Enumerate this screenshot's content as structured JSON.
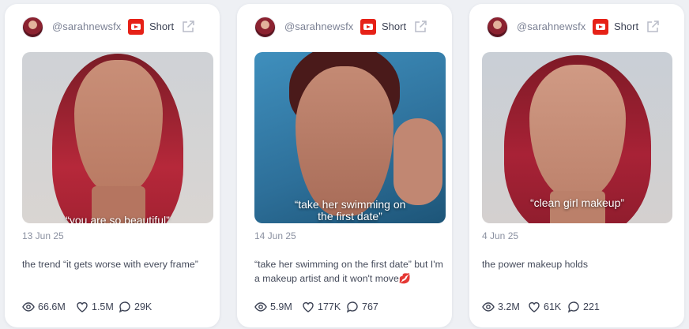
{
  "posts": [
    {
      "author": "@sarahnewsfx",
      "platform": "youtube",
      "type_label": "Short",
      "thumbnail_caption": "“you are so beautiful”",
      "date": "13 Jun 25",
      "description": "the trend “it gets worse with every frame”",
      "views": "66.6M",
      "likes": "1.5M",
      "comments": "29K"
    },
    {
      "author": "@sarahnewsfx",
      "platform": "youtube",
      "type_label": "Short",
      "thumbnail_caption": "“take her swimming on the first date”",
      "date": "14 Jun 25",
      "description": "“take her swimming on the first date” but I'm a makeup artist and it won't move💋",
      "views": "5.9M",
      "likes": "177K",
      "comments": "767"
    },
    {
      "author": "@sarahnewsfx",
      "platform": "youtube",
      "type_label": "Short",
      "thumbnail_caption": "“clean girl makeup”",
      "date": "4 Jun 25",
      "description": "the power makeup holds",
      "views": "3.2M",
      "likes": "61K",
      "comments": "221"
    }
  ],
  "colors": {
    "youtube_red": "#e62117",
    "muted_text": "#8a90a0",
    "body_text": "#444a5a",
    "lip_emoji": "#d81b8f"
  },
  "icons": {
    "platform": "youtube-icon",
    "external": "external-link-icon",
    "views": "eye-icon",
    "likes": "heart-icon",
    "comments": "comment-icon"
  }
}
